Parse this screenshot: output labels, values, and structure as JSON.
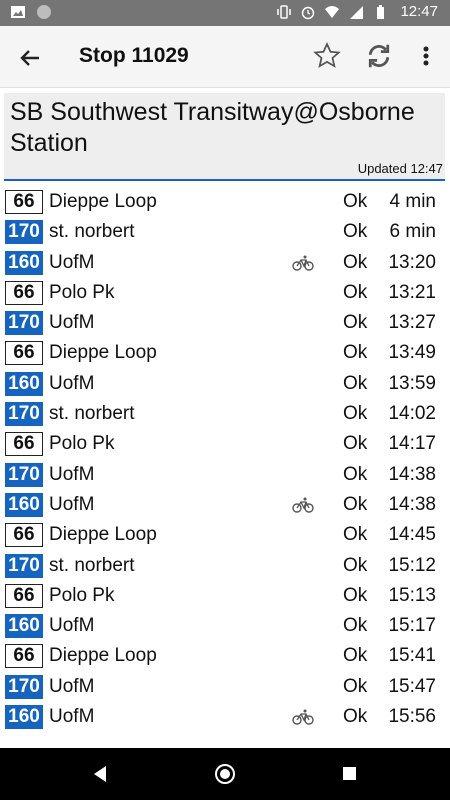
{
  "status_bar": {
    "time": "12:47",
    "icons": [
      "image-icon",
      "circle-icon",
      "vibrate-icon",
      "alarm-icon",
      "wifi-icon",
      "signal-icon",
      "battery-icon"
    ]
  },
  "app_bar": {
    "title": "Stop 11029",
    "icons": [
      "back-arrow-icon",
      "star-outline-icon",
      "refresh-icon",
      "more-vert-icon"
    ]
  },
  "stop": {
    "name": "SB Southwest Transitway@Osborne Station",
    "updated": "Updated 12:47",
    "accent_color": "#1565c0"
  },
  "departures": [
    {
      "route": "66",
      "style": "white",
      "destination": "Dieppe Loop",
      "bike": false,
      "status": "Ok",
      "time": "4 min"
    },
    {
      "route": "170",
      "style": "blue",
      "destination": "st. norbert",
      "bike": false,
      "status": "Ok",
      "time": "6 min"
    },
    {
      "route": "160",
      "style": "blue",
      "destination": "UofM",
      "bike": true,
      "status": "Ok",
      "time": "13:20"
    },
    {
      "route": "66",
      "style": "white",
      "destination": "Polo Pk",
      "bike": false,
      "status": "Ok",
      "time": "13:21"
    },
    {
      "route": "170",
      "style": "blue",
      "destination": "UofM",
      "bike": false,
      "status": "Ok",
      "time": "13:27"
    },
    {
      "route": "66",
      "style": "white",
      "destination": "Dieppe Loop",
      "bike": false,
      "status": "Ok",
      "time": "13:49"
    },
    {
      "route": "160",
      "style": "blue",
      "destination": "UofM",
      "bike": false,
      "status": "Ok",
      "time": "13:59"
    },
    {
      "route": "170",
      "style": "blue",
      "destination": "st. norbert",
      "bike": false,
      "status": "Ok",
      "time": "14:02"
    },
    {
      "route": "66",
      "style": "white",
      "destination": "Polo Pk",
      "bike": false,
      "status": "Ok",
      "time": "14:17"
    },
    {
      "route": "170",
      "style": "blue",
      "destination": "UofM",
      "bike": false,
      "status": "Ok",
      "time": "14:38"
    },
    {
      "route": "160",
      "style": "blue",
      "destination": "UofM",
      "bike": true,
      "status": "Ok",
      "time": "14:38"
    },
    {
      "route": "66",
      "style": "white",
      "destination": "Dieppe Loop",
      "bike": false,
      "status": "Ok",
      "time": "14:45"
    },
    {
      "route": "170",
      "style": "blue",
      "destination": "st. norbert",
      "bike": false,
      "status": "Ok",
      "time": "15:12"
    },
    {
      "route": "66",
      "style": "white",
      "destination": "Polo Pk",
      "bike": false,
      "status": "Ok",
      "time": "15:13"
    },
    {
      "route": "160",
      "style": "blue",
      "destination": "UofM",
      "bike": false,
      "status": "Ok",
      "time": "15:17"
    },
    {
      "route": "66",
      "style": "white",
      "destination": "Dieppe Loop",
      "bike": false,
      "status": "Ok",
      "time": "15:41"
    },
    {
      "route": "170",
      "style": "blue",
      "destination": "UofM",
      "bike": false,
      "status": "Ok",
      "time": "15:47"
    },
    {
      "route": "160",
      "style": "blue",
      "destination": "UofM",
      "bike": true,
      "status": "Ok",
      "time": "15:56"
    }
  ],
  "nav_bar": {
    "icons": [
      "nav-back-icon",
      "nav-home-icon",
      "nav-recents-icon"
    ]
  }
}
